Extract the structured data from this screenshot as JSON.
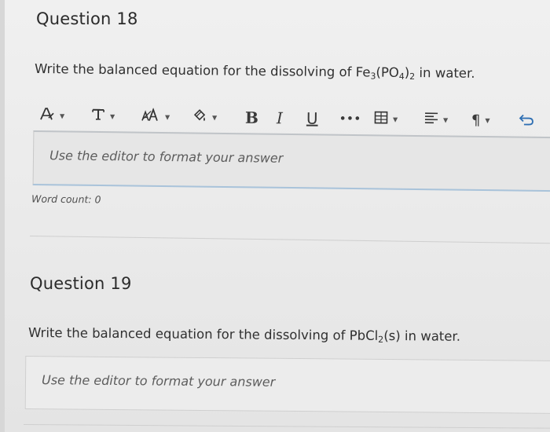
{
  "question18": {
    "title": "Question 18",
    "prompt_before": "Write the balanced equation for the dissolving of Fe",
    "prompt_sub1": "3",
    "prompt_mid1": "(PO",
    "prompt_sub2": "4",
    "prompt_mid2": ")",
    "prompt_sub3": "2",
    "prompt_after": " in water.",
    "editor_placeholder": "Use the editor to format your answer",
    "word_count": "Word count: 0"
  },
  "toolbar": {
    "buttons": [
      {
        "name": "font-color",
        "glyph": "A̸",
        "caret": "▼"
      },
      {
        "name": "text-style",
        "glyph": "T",
        "caret": "▼"
      },
      {
        "name": "font-size",
        "glyph": "A͟A",
        "caret": "▼"
      },
      {
        "name": "highlight",
        "glyph": "◈",
        "caret": "▼"
      },
      {
        "name": "bold",
        "glyph": "B"
      },
      {
        "name": "italic",
        "glyph": "I"
      },
      {
        "name": "underline",
        "glyph": "U"
      },
      {
        "name": "more",
        "glyph": "•••"
      },
      {
        "name": "table",
        "glyph": "⊞",
        "caret": "▼"
      },
      {
        "name": "align",
        "glyph": "≡",
        "caret": "▼"
      },
      {
        "name": "paragraph",
        "glyph": "¶",
        "caret": "▼"
      },
      {
        "name": "undo",
        "glyph": "↶"
      }
    ]
  },
  "question19": {
    "title": "Question 19",
    "prompt_before": "Write the balanced equation for the dissolving of PbCl",
    "prompt_sub1": "2",
    "prompt_after": "(s) in water.",
    "editor_placeholder": "Use the editor to format your answer"
  }
}
